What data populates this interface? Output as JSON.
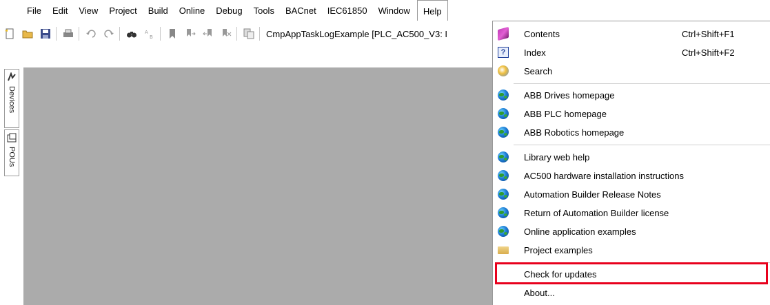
{
  "menubar": {
    "items": [
      "File",
      "Edit",
      "View",
      "Project",
      "Build",
      "Online",
      "Debug",
      "Tools",
      "BACnet",
      "IEC61850",
      "Window",
      "Help"
    ]
  },
  "toolbar": {
    "project_title": "CmpAppTaskLogExample [PLC_AC500_V3: I"
  },
  "dock": {
    "tabs": [
      "Devices",
      "POUs"
    ]
  },
  "help_menu": {
    "items": [
      {
        "label": "Contents",
        "shortcut": "Ctrl+Shift+F1",
        "icon": "book-icon"
      },
      {
        "label": "Index",
        "shortcut": "Ctrl+Shift+F2",
        "icon": "help-index-icon"
      },
      {
        "label": "Search",
        "shortcut": "",
        "icon": "search-icon"
      },
      {
        "label": "ABB Drives homepage",
        "shortcut": "",
        "icon": "globe-icon"
      },
      {
        "label": "ABB PLC homepage",
        "shortcut": "",
        "icon": "globe-icon"
      },
      {
        "label": "ABB Robotics homepage",
        "shortcut": "",
        "icon": "globe-icon"
      },
      {
        "label": "Library web help",
        "shortcut": "",
        "icon": "globe-icon"
      },
      {
        "label": "AC500 hardware installation instructions",
        "shortcut": "",
        "icon": "globe-icon"
      },
      {
        "label": "Automation Builder Release Notes",
        "shortcut": "",
        "icon": "globe-icon"
      },
      {
        "label": "Return of Automation Builder license",
        "shortcut": "",
        "icon": "globe-icon"
      },
      {
        "label": "Online application examples",
        "shortcut": "",
        "icon": "globe-icon"
      },
      {
        "label": "Project examples",
        "shortcut": "",
        "icon": "folder-icon"
      },
      {
        "label": "Check for updates",
        "shortcut": "",
        "icon": ""
      },
      {
        "label": "About...",
        "shortcut": "",
        "icon": ""
      }
    ]
  },
  "colors": {
    "highlight": "#e8001c",
    "workspace": "#ababab"
  }
}
